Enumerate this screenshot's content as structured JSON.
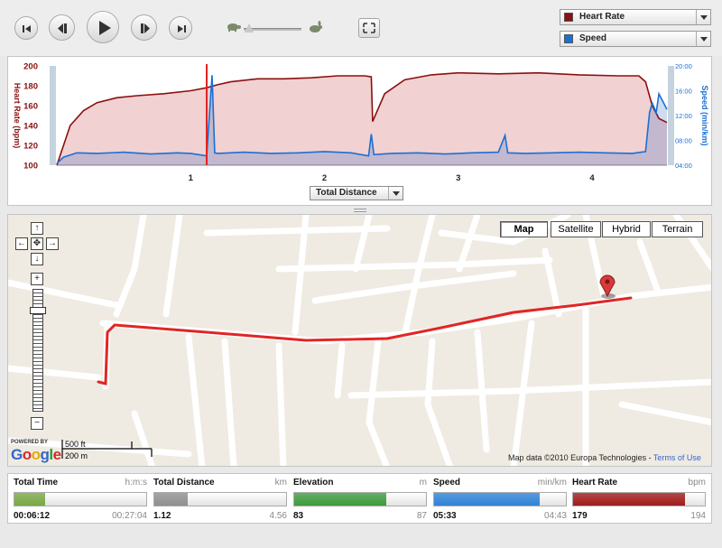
{
  "player": {
    "buttons": [
      "skip-back",
      "step-back",
      "play",
      "step-forward",
      "skip-forward"
    ],
    "speed_slider": {
      "level": 0.1,
      "slow_icon": "turtle-icon",
      "fast_icon": "rabbit-icon"
    },
    "fullscreen_icon": "fullscreen-icon"
  },
  "series_selectors": [
    {
      "label": "Heart Rate",
      "color": "#8b1010"
    },
    {
      "label": "Speed",
      "color": "#1a6fd6"
    }
  ],
  "chart_data": {
    "type": "area",
    "x_selector_label": "Total Distance",
    "x_ticks": [
      "1",
      "2",
      "3",
      "4"
    ],
    "xlim": [
      0,
      4.56
    ],
    "marker_x": 1.12,
    "left_axis": {
      "label": "Heart Rate (bpm)",
      "ticks": [
        "200",
        "180",
        "160",
        "140",
        "120",
        "100"
      ],
      "ylim": [
        100,
        200
      ],
      "color": "#8b1010"
    },
    "right_axis": {
      "label": "Speed (min/km)",
      "ticks": [
        "20:00",
        "16:00",
        "12:00",
        "08:00",
        "04:00"
      ],
      "ylim": [
        4,
        20
      ],
      "color": "#1a6fd6"
    },
    "series": [
      {
        "name": "Heart Rate",
        "x": [
          0.0,
          0.05,
          0.1,
          0.2,
          0.3,
          0.45,
          0.6,
          0.8,
          1.0,
          1.12,
          1.2,
          1.3,
          1.5,
          1.7,
          1.9,
          2.1,
          2.3,
          2.35,
          2.36,
          2.45,
          2.6,
          2.8,
          3.0,
          3.3,
          3.6,
          3.9,
          4.2,
          4.35,
          4.4,
          4.45,
          4.5,
          4.56
        ],
        "values": [
          100,
          120,
          140,
          155,
          163,
          168,
          170,
          172,
          175,
          178,
          181,
          184,
          187,
          187,
          188,
          190,
          190,
          189,
          144,
          172,
          186,
          191,
          193,
          192,
          193,
          191,
          190,
          190,
          184,
          160,
          147,
          143
        ]
      },
      {
        "name": "Speed",
        "x": [
          0.0,
          0.05,
          0.15,
          0.3,
          0.5,
          0.7,
          0.9,
          1.0,
          1.12,
          1.16,
          1.18,
          1.2,
          1.4,
          1.6,
          1.8,
          2.0,
          2.2,
          2.33,
          2.35,
          2.37,
          2.5,
          2.7,
          2.9,
          3.1,
          3.3,
          3.35,
          3.37,
          3.5,
          3.7,
          3.9,
          4.1,
          4.3,
          4.4,
          4.43,
          4.45,
          4.48,
          4.5,
          4.56
        ],
        "values": [
          4.3,
          5.3,
          6.0,
          5.9,
          6.1,
          5.8,
          6.0,
          5.9,
          5.5,
          18.5,
          6.0,
          5.9,
          6.1,
          5.9,
          6.0,
          6.2,
          6.0,
          5.5,
          9.0,
          5.7,
          5.9,
          6.0,
          5.8,
          6.0,
          6.1,
          8.8,
          6.0,
          5.9,
          6.0,
          6.1,
          6.0,
          5.9,
          6.2,
          12.5,
          14.0,
          12.5,
          15.5,
          13.0
        ]
      }
    ]
  },
  "map": {
    "types": [
      "Map",
      "Satellite",
      "Hybrid",
      "Terrain"
    ],
    "selected_type": "Map",
    "nav": {
      "up": "↑",
      "down": "↓",
      "left": "←",
      "right": "→",
      "center": "✥",
      "zoom_in": "+",
      "zoom_out": "−"
    },
    "zoom_level": 0.15,
    "scale_ft": "500 ft",
    "scale_m": "200 m",
    "powered_by": "POWERED BY",
    "logo": "Google",
    "credit": "Map data ©2010  Europa Technologies - ",
    "terms": "Terms of Use"
  },
  "stats": [
    {
      "label": "Total Time",
      "unit": "h:m:s",
      "value": "00:06:12",
      "max": "00:27:04",
      "fraction": 0.23,
      "color": "#7aa845"
    },
    {
      "label": "Total Distance",
      "unit": "km",
      "value": "1.12",
      "max": "4.56",
      "fraction": 0.25,
      "color": "#909090"
    },
    {
      "label": "Elevation",
      "unit": "m",
      "value": "83",
      "max": "87",
      "fraction": 0.7,
      "color": "#3f9b3f"
    },
    {
      "label": "Speed",
      "unit": "min/km",
      "value": "05:33",
      "max": "04:43",
      "fraction": 0.8,
      "color": "#2f83d8"
    },
    {
      "label": "Heart Rate",
      "unit": "bpm",
      "value": "179",
      "max": "194",
      "fraction": 0.85,
      "color": "#a11c1c"
    }
  ]
}
